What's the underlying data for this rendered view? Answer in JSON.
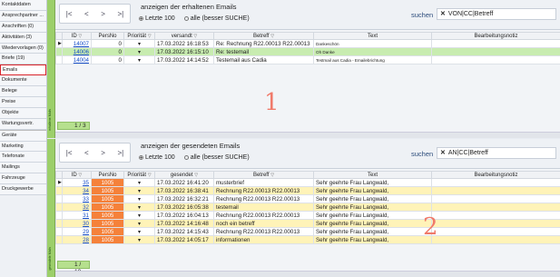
{
  "sidebar": {
    "items": [
      {
        "label": "Kontaktdaten"
      },
      {
        "label": "Ansprechpartner ..."
      },
      {
        "label": "Anschriften (0)"
      },
      {
        "label": "Aktivitäten (3)"
      },
      {
        "label": "Wiedervorlagen (0)"
      },
      {
        "label": "Briefe (19)"
      },
      {
        "label": "Emails",
        "active": true
      },
      {
        "label": "Dokumente"
      },
      {
        "label": "Belege"
      },
      {
        "label": "Preise"
      },
      {
        "label": "Objekte"
      },
      {
        "label": "Wartungsvertr."
      },
      {
        "label": "Geräte"
      },
      {
        "label": "Marketing"
      },
      {
        "label": "Telefonate"
      },
      {
        "label": "Mailings"
      },
      {
        "label": "Fahrzeuge"
      },
      {
        "label": "Druckgewerbe"
      }
    ]
  },
  "received": {
    "group_title": "anzeigen der erhaltenen Emails",
    "option_recent": "Letzte 100",
    "option_all": "alle (besser SUCHE)",
    "search_label": "suchen",
    "search_value": "VON|CC|Betreff",
    "strip_label": "erhaltene Mails",
    "columns": [
      "ID",
      "PersNo",
      "Priorität",
      "versandt",
      "Betreff",
      "Text",
      "Bearbeitungsnotiz"
    ],
    "rows": [
      {
        "id": "14007",
        "persno": "0",
        "prio": "▾",
        "sent": "17.03.2022 16:18:53",
        "subject": "Re: Rechnung R22.00013 R22.00013",
        "text": "Dankeschön",
        "note": ""
      },
      {
        "id": "14006",
        "persno": "0",
        "prio": "▾",
        "sent": "17.03.2022 16:15:10",
        "subject": "Re: testemail",
        "text": "Oh Danke",
        "note": ""
      },
      {
        "id": "14004",
        "persno": "0",
        "prio": "▾",
        "sent": "17.03.2022 14:14:52",
        "subject": "Testemail aus Cadia",
        "text": "Testmail aus Cadia - Emailebrichtung",
        "note": ""
      }
    ],
    "status": "1 / 3",
    "annotation": "1"
  },
  "sent": {
    "group_title": "anzeigen der gesendeten Emails",
    "option_recent": "Letzte 100",
    "option_all": "alle (besser SUCHE)",
    "search_label": "suchen",
    "search_value": "AN|CC|Betreff",
    "strip_label": "gesendete Mails",
    "columns": [
      "ID",
      "PersNo",
      "Priorität",
      "gesendet",
      "Betreff",
      "Text",
      "Bearbeitungsnotiz"
    ],
    "rows": [
      {
        "id": "35",
        "persno": "1005",
        "prio": "▾",
        "sent": "17.03.2022 16:41:20",
        "subject": "musterbrief",
        "text": "Sehr geehrte Frau Langwald,",
        "note": ""
      },
      {
        "id": "34",
        "persno": "1005",
        "prio": "▾",
        "sent": "17.03.2022 16:38:41",
        "subject": "Rechnung R22.00013 R22.00013",
        "text": "Sehr geehrte Frau Langwald,",
        "note": ""
      },
      {
        "id": "33",
        "persno": "1005",
        "prio": "▾",
        "sent": "17.03.2022 16:32:21",
        "subject": "Rechnung R22.00013 R22.00013",
        "text": "Sehr geehrte Frau Langwald,",
        "note": ""
      },
      {
        "id": "32",
        "persno": "1005",
        "prio": "▾",
        "sent": "17.03.2022 16:05:38",
        "subject": "testemail",
        "text": "Sehr geehrte Frau Langwald,",
        "note": ""
      },
      {
        "id": "31",
        "persno": "1005",
        "prio": "▾",
        "sent": "17.03.2022 16:04:13",
        "subject": "Rechnung R22.00013 R22.00013",
        "text": "Sehr geehrte Frau Langwald,",
        "note": ""
      },
      {
        "id": "30",
        "persno": "1005",
        "prio": "▾",
        "sent": "17.03.2022 14:16:48",
        "subject": "noch ein betreff",
        "text": "Sehr geehrte Frau Langwald,",
        "note": ""
      },
      {
        "id": "29",
        "persno": "1005",
        "prio": "▾",
        "sent": "17.03.2022 14:15:43",
        "subject": "Rechnung R22.00013 R22.00013",
        "text": "Sehr geehrte Frau Langwald,",
        "note": ""
      },
      {
        "id": "28",
        "persno": "1005",
        "prio": "▾",
        "sent": "17.03.2022 14:05:17",
        "subject": "informationen",
        "text": "Sehr geehrte Frau Langwald,",
        "note": ""
      }
    ],
    "status": "1 / 10",
    "annotation": "2"
  },
  "nav": {
    "first": "|<",
    "prev": "<",
    "next": ">",
    "last": ">|"
  },
  "colors": {
    "accent_green": "#b6e08e",
    "persno_orange": "#f5813a",
    "selected_row": "#c8ecb0",
    "alt_row_yellow": "#fff3b8",
    "annotation_red": "#f07a6a"
  }
}
